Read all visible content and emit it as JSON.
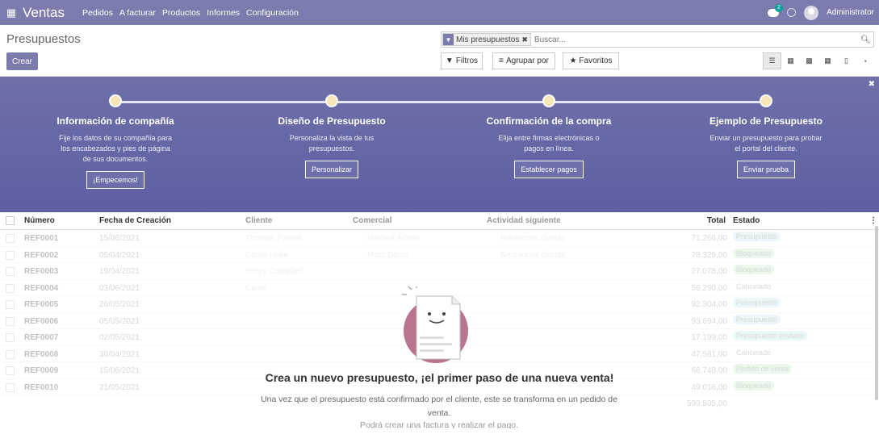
{
  "topbar": {
    "brand": "Ventas",
    "menu": [
      "Pedidos",
      "A facturar",
      "Productos",
      "Informes",
      "Configuración"
    ],
    "chat_count": "2",
    "user": "Administrator"
  },
  "control": {
    "title": "Presupuestos",
    "create": "Crear",
    "facet": "Mis presupuestos",
    "search_placeholder": "Buscar...",
    "filters": "Filtros",
    "group_by": "Agrupar por",
    "favorites": "Favoritos"
  },
  "steps": [
    {
      "title": "Información de compañía",
      "desc": [
        "Fije los datos de su compañía para",
        "los encabezados y pies de página",
        "de sus documentos."
      ],
      "button": "¡Empecemos!"
    },
    {
      "title": "Diseño de Presupuesto",
      "desc": [
        "Personaliza la vista de tus",
        "presupuestos."
      ],
      "button": "Personalizar"
    },
    {
      "title": "Confirmación de la compra",
      "desc": [
        "Elija entre firmas electrónicas o",
        "pagos en línea."
      ],
      "button": "Establecer pagos"
    },
    {
      "title": "Ejemplo de Presupuesto",
      "desc": [
        "Enviar un presupuesto para probar",
        "el portal del cliente."
      ],
      "button": "Enviar prueba"
    }
  ],
  "table": {
    "headers": {
      "number": "Número",
      "date": "Fecha de Creación",
      "client": "Cliente",
      "salesperson": "Comercial",
      "activity": "Actividad siguiente",
      "total": "Total",
      "status": "Estado"
    },
    "rows": [
      {
        "ref": "REF0001",
        "date": "15/06/2021",
        "client": "Thomas Passot",
        "sales": "Mitchell Admin",
        "activity": "Reuniones diarias",
        "total": "71.266,00",
        "status": "Presupuesto",
        "tag": "blue"
      },
      {
        "ref": "REF0002",
        "date": "05/04/2021",
        "client": "Carrie Helle",
        "sales": "Marc Demo",
        "activity": "Reuniones diarias",
        "total": "78.329,00",
        "status": "Bloqueado",
        "tag": "green"
      },
      {
        "ref": "REF0003",
        "date": "19/04/2021",
        "client": "Henry Campbell",
        "sales": "",
        "activity": "",
        "total": "27.078,00",
        "status": "Bloqueado",
        "tag": "green"
      },
      {
        "ref": "REF0004",
        "date": "03/06/2021",
        "client": "Carrie",
        "sales": "",
        "activity": "",
        "total": "56.290,00",
        "status": "Cancelado",
        "tag": "none"
      },
      {
        "ref": "REF0005",
        "date": "26/05/2021",
        "client": "",
        "sales": "",
        "activity": "",
        "total": "92.304,00",
        "status": "Presupuesto",
        "tag": "blue"
      },
      {
        "ref": "REF0006",
        "date": "05/05/2021",
        "client": "",
        "sales": "",
        "activity": "",
        "total": "93.694,00",
        "status": "Presupuesto",
        "tag": "blue"
      },
      {
        "ref": "REF0007",
        "date": "02/05/2021",
        "client": "",
        "sales": "",
        "activity": "",
        "total": "17.199,00",
        "status": "Presupuesto enviado",
        "tag": "blue"
      },
      {
        "ref": "REF0008",
        "date": "30/04/2021",
        "client": "",
        "sales": "",
        "activity": "",
        "total": "47.581,00",
        "status": "Cancelado",
        "tag": "none"
      },
      {
        "ref": "REF0009",
        "date": "15/06/2021",
        "client": "",
        "sales": "",
        "activity": "",
        "total": "66.748,00",
        "status": "Pedido de venta",
        "tag": "green"
      },
      {
        "ref": "REF0010",
        "date": "21/05/2021",
        "client": "",
        "sales": "",
        "activity": "",
        "total": "49.016,00",
        "status": "Bloqueado",
        "tag": "green"
      }
    ],
    "grand_total": "599.505,00"
  },
  "nocontent": {
    "title": "Crea un nuevo presupuesto, ¡el primer paso de una nueva venta!",
    "desc": "Una vez que el presupuesto está confirmado por el cliente, este se transforma en un pedido de venta.",
    "desc2": "Podrá crear una factura y realizar el pago."
  },
  "colors": {
    "brand": "#7c7bad",
    "banner": "#5d5fa3",
    "tag_blue": "#d4eef5",
    "tag_green": "#d8f0d6"
  }
}
